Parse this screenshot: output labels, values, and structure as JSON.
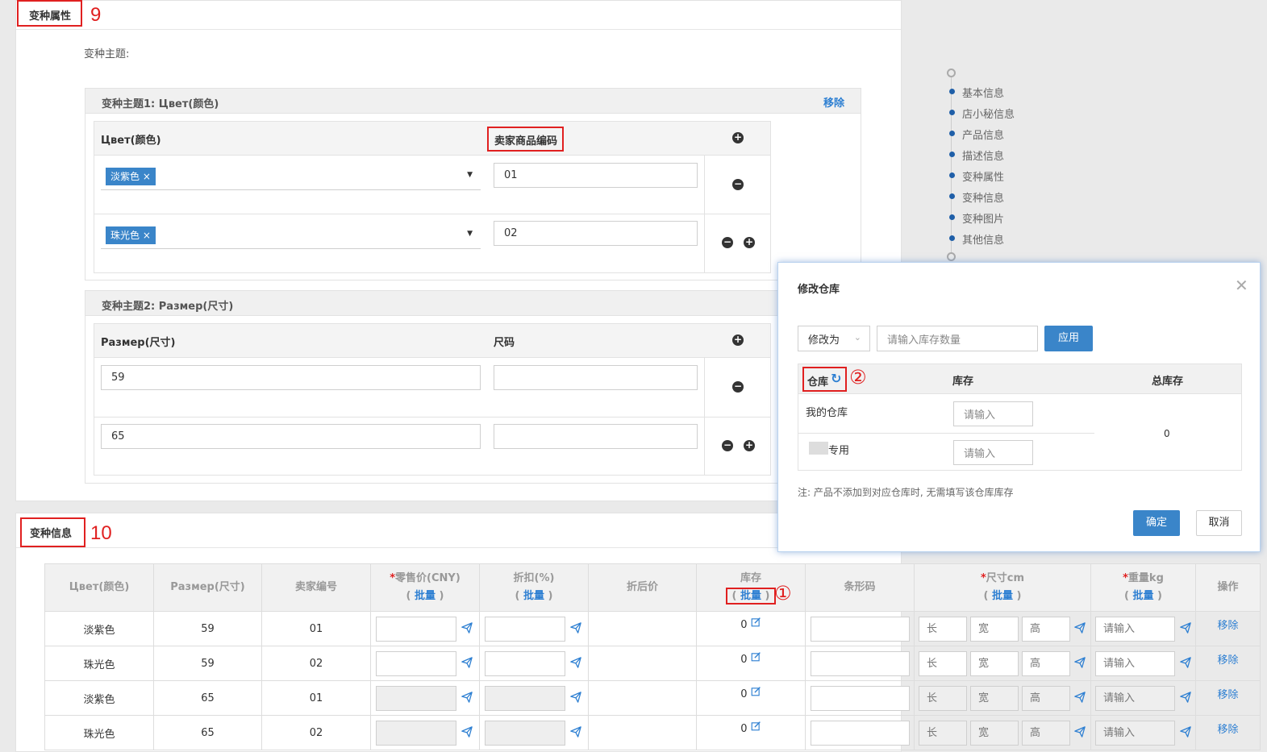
{
  "variant_attrs": {
    "section_title": "变种属性",
    "section_number": "9",
    "theme_label": "变种主题:",
    "theme1": {
      "title": "变种主题1: Цвет(颜色)",
      "remove": "移除",
      "col1": "Цвет(颜色)",
      "col2": "卖家商品编码",
      "rows": [
        {
          "tag": "淡紫色",
          "code": "01"
        },
        {
          "tag": "珠光色",
          "code": "02"
        }
      ]
    },
    "theme2": {
      "title": "变种主题2: Размер(尺寸)",
      "col1": "Размер(尺寸)",
      "col2": "尺码",
      "rows": [
        {
          "value": "59",
          "size": ""
        },
        {
          "value": "65",
          "size": ""
        }
      ]
    }
  },
  "side_nav": {
    "items": [
      "基本信息",
      "店小秘信息",
      "产品信息",
      "描述信息",
      "变种属性",
      "变种信息",
      "变种图片",
      "其他信息"
    ]
  },
  "variant_info": {
    "section_title": "变种信息",
    "section_number": "10",
    "headers": {
      "color": "Цвет(颜色)",
      "size": "Размер(尺寸)",
      "seller_code": "卖家编号",
      "retail_price": "零售价(CNY)",
      "discount": "折扣(%)",
      "after_discount": "折后价",
      "stock": "库存",
      "barcode": "条形码",
      "dimension": "尺寸cm",
      "weight": "重量kg",
      "action": "操作",
      "batch": "批量",
      "required": "*"
    },
    "stock_marker": "①",
    "placeholders": {
      "length": "长",
      "width": "宽",
      "height": "高",
      "weight": "请输入"
    },
    "remove": "移除",
    "rows": [
      {
        "color": "淡紫色",
        "size": "59",
        "code": "01",
        "stock": "0"
      },
      {
        "color": "珠光色",
        "size": "59",
        "code": "02",
        "stock": "0"
      },
      {
        "color": "淡紫色",
        "size": "65",
        "code": "01",
        "stock": "0"
      },
      {
        "color": "珠光色",
        "size": "65",
        "code": "02",
        "stock": "0"
      }
    ]
  },
  "dialog": {
    "title": "修改仓库",
    "mode_select": "修改为",
    "qty_placeholder": "请输入库存数量",
    "apply": "应用",
    "col_warehouse": "仓库",
    "col_stock": "库存",
    "col_total": "总库存",
    "marker": "②",
    "rows": [
      {
        "name": "我的仓库",
        "placeholder": "请输入"
      },
      {
        "name": "专用",
        "placeholder": "请输入"
      }
    ],
    "total": "0",
    "note": "注: 产品不添加到对应仓库时, 无需填写该仓库库存",
    "confirm": "确定",
    "cancel": "取消"
  }
}
